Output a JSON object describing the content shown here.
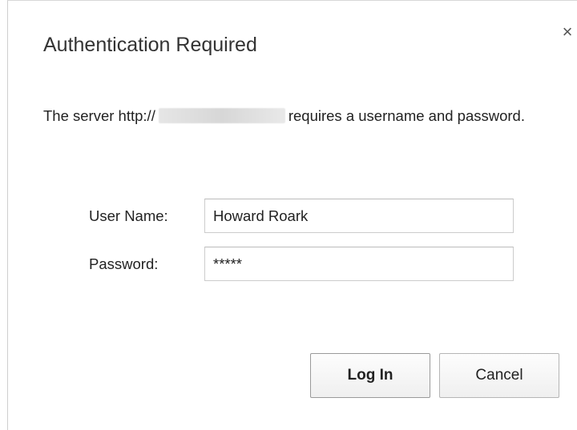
{
  "dialog": {
    "title": "Authentication Required",
    "close_glyph": "×",
    "message_prefix": "The server http://",
    "message_suffix": "requires a username and password."
  },
  "form": {
    "username_label": "User Name:",
    "username_value": "Howard Roark",
    "password_label": "Password:",
    "password_value": "*****"
  },
  "buttons": {
    "login_label": "Log In",
    "cancel_label": "Cancel"
  },
  "icons": {
    "close": "close-icon"
  }
}
